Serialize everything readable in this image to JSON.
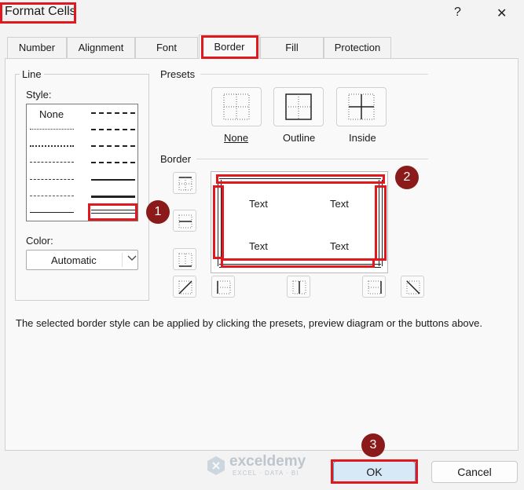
{
  "window": {
    "title": "Format Cells",
    "help": "?",
    "close": "✕"
  },
  "tabs": [
    "Number",
    "Alignment",
    "Font",
    "Border",
    "Fill",
    "Protection"
  ],
  "line": {
    "group_label": "Line",
    "style_label": "Style:",
    "none_label": "None",
    "color_label": "Color:",
    "color_value": "Automatic"
  },
  "presets": {
    "group_label": "Presets",
    "items": [
      "None",
      "Outline",
      "Inside"
    ]
  },
  "border": {
    "group_label": "Border",
    "preview_text": [
      "Text",
      "Text",
      "Text",
      "Text"
    ]
  },
  "hint": "The selected border style can be applied by clicking the presets, preview diagram or the buttons above.",
  "markers": [
    "1",
    "2",
    "3"
  ],
  "watermark": {
    "brand": "exceldemy",
    "tagline": "EXCEL · DATA · BI"
  },
  "footer": {
    "ok": "OK",
    "cancel": "Cancel"
  },
  "colors": {
    "highlight": "#e0191e",
    "marker": "#8b1a1a",
    "ok_bg": "#d7e8f7"
  }
}
